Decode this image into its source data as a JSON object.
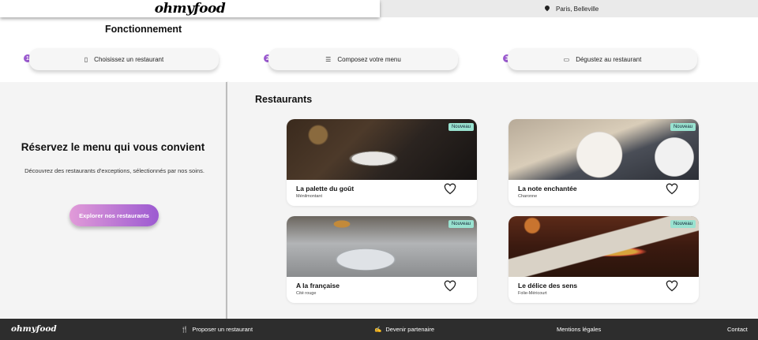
{
  "header": {
    "logo": "ohmyfood",
    "location": "Paris, Belleville",
    "location_icon": "map-pin-icon"
  },
  "how_it_works": {
    "title": "Fonctionnement",
    "steps": [
      {
        "number": "1",
        "label": "Choisissez un restaurant",
        "icon": "mobile-phone-icon"
      },
      {
        "number": "2",
        "label": "Composez votre menu",
        "icon": "list-icon"
      },
      {
        "number": "3",
        "label": "Dégustez au restaurant",
        "icon": "dish-icon"
      }
    ]
  },
  "hero": {
    "title": "Réservez le menu qui vous convient",
    "text": "Découvrez des restaurants d'exceptions, sélectionnés par nos soins.",
    "button": "Explorer nos restaurants"
  },
  "restaurants": {
    "title": "Restaurants",
    "items": [
      {
        "name": "La palette du goût",
        "location": "Ménilmontant",
        "badge": "Nouveau"
      },
      {
        "name": "La note enchantée",
        "location": "Charonne",
        "badge": "Nouveau"
      },
      {
        "name": "A la française",
        "location": "Cité rouge",
        "badge": "Nouveau"
      },
      {
        "name": "Le délice des sens",
        "location": "Folie-Méricourt",
        "badge": "Nouveau"
      }
    ]
  },
  "footer": {
    "logo": "ohmyfood",
    "links": [
      {
        "label": "Proposer un restaurant",
        "icon": "utensils-icon"
      },
      {
        "label": "Devenir partenaire",
        "icon": "handshake-icon"
      },
      {
        "label": "Mentions légales",
        "icon": ""
      },
      {
        "label": "Contact",
        "icon": ""
      }
    ]
  },
  "colors": {
    "accent_purple": "#9b59d0",
    "accent_pink": "#e19bd8",
    "badge_green": "#99e2d0",
    "footer_bg": "#2d2d2d"
  }
}
